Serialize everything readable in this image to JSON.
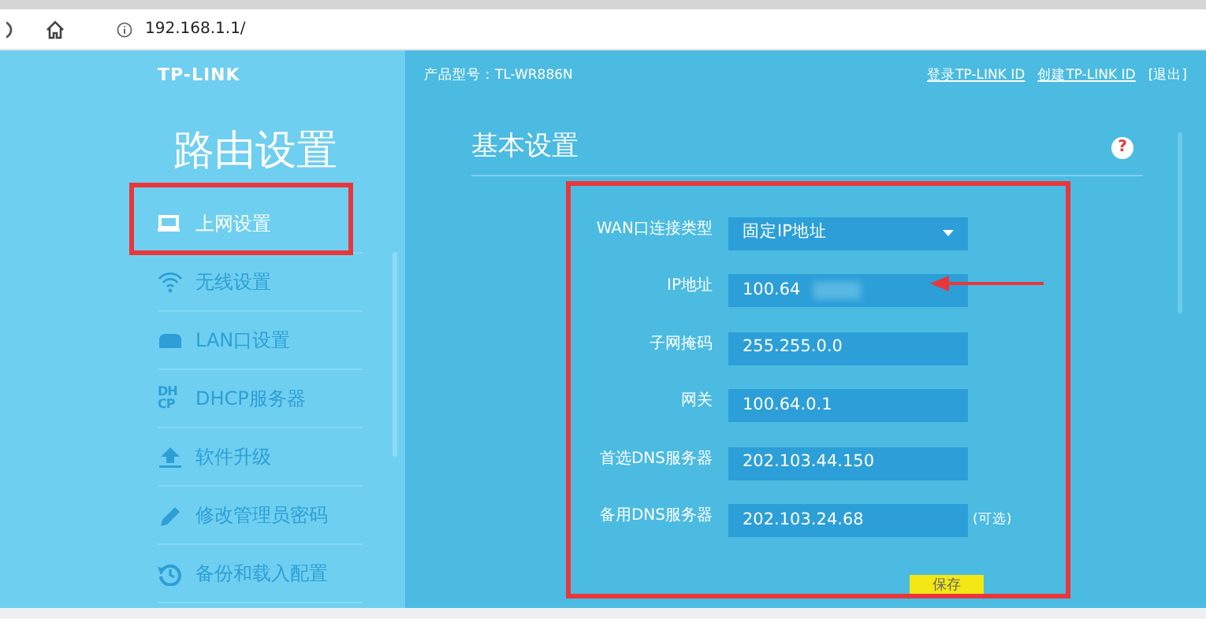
{
  "browser": {
    "url": "192.168.1.1/"
  },
  "header": {
    "logo": "TP-LINK",
    "product": "产品型号：TL-WR886N",
    "links": [
      {
        "label": "登录TP-LINK ID",
        "kind": "link"
      },
      {
        "label": "创建TP-LINK ID",
        "kind": "link"
      },
      {
        "label": "[退出]",
        "kind": "plain"
      }
    ]
  },
  "sidebar": {
    "title": "路由设置",
    "items": [
      {
        "label": "上网设置",
        "selected": true,
        "highlighted": true
      },
      {
        "label": "无线设置",
        "selected": false,
        "highlighted": false
      },
      {
        "label": "LAN口设置",
        "selected": false,
        "highlighted": false
      },
      {
        "label": "DHCP服务器",
        "icon_text": "DH CP",
        "selected": false,
        "highlighted": false
      },
      {
        "label": "软件升级",
        "selected": false,
        "highlighted": false
      },
      {
        "label": "修改管理员密码",
        "selected": false,
        "highlighted": false
      },
      {
        "label": "备份和载入配置",
        "selected": false,
        "highlighted": false
      }
    ]
  },
  "content": {
    "title": "基本设置",
    "help": "?",
    "highlighted": true,
    "fields": [
      {
        "label": "WAN口连接类型",
        "kind": "select",
        "value": "固定IP地址",
        "arrow": false
      },
      {
        "label": "IP地址",
        "kind": "text",
        "value": "100.64",
        "blurred": true,
        "arrow": true
      },
      {
        "label": "子网掩码",
        "kind": "text",
        "value": "255.255.0.0",
        "arrow": false
      },
      {
        "label": "网关",
        "kind": "text",
        "value": "100.64.0.1",
        "arrow": false
      },
      {
        "label": "首选DNS服务器",
        "kind": "text",
        "value": "202.103.44.150",
        "arrow": false
      },
      {
        "label": "备用DNS服务器",
        "kind": "text",
        "value": "202.103.24.68",
        "note": "(可选)",
        "arrow": false
      }
    ],
    "save": "保存"
  }
}
